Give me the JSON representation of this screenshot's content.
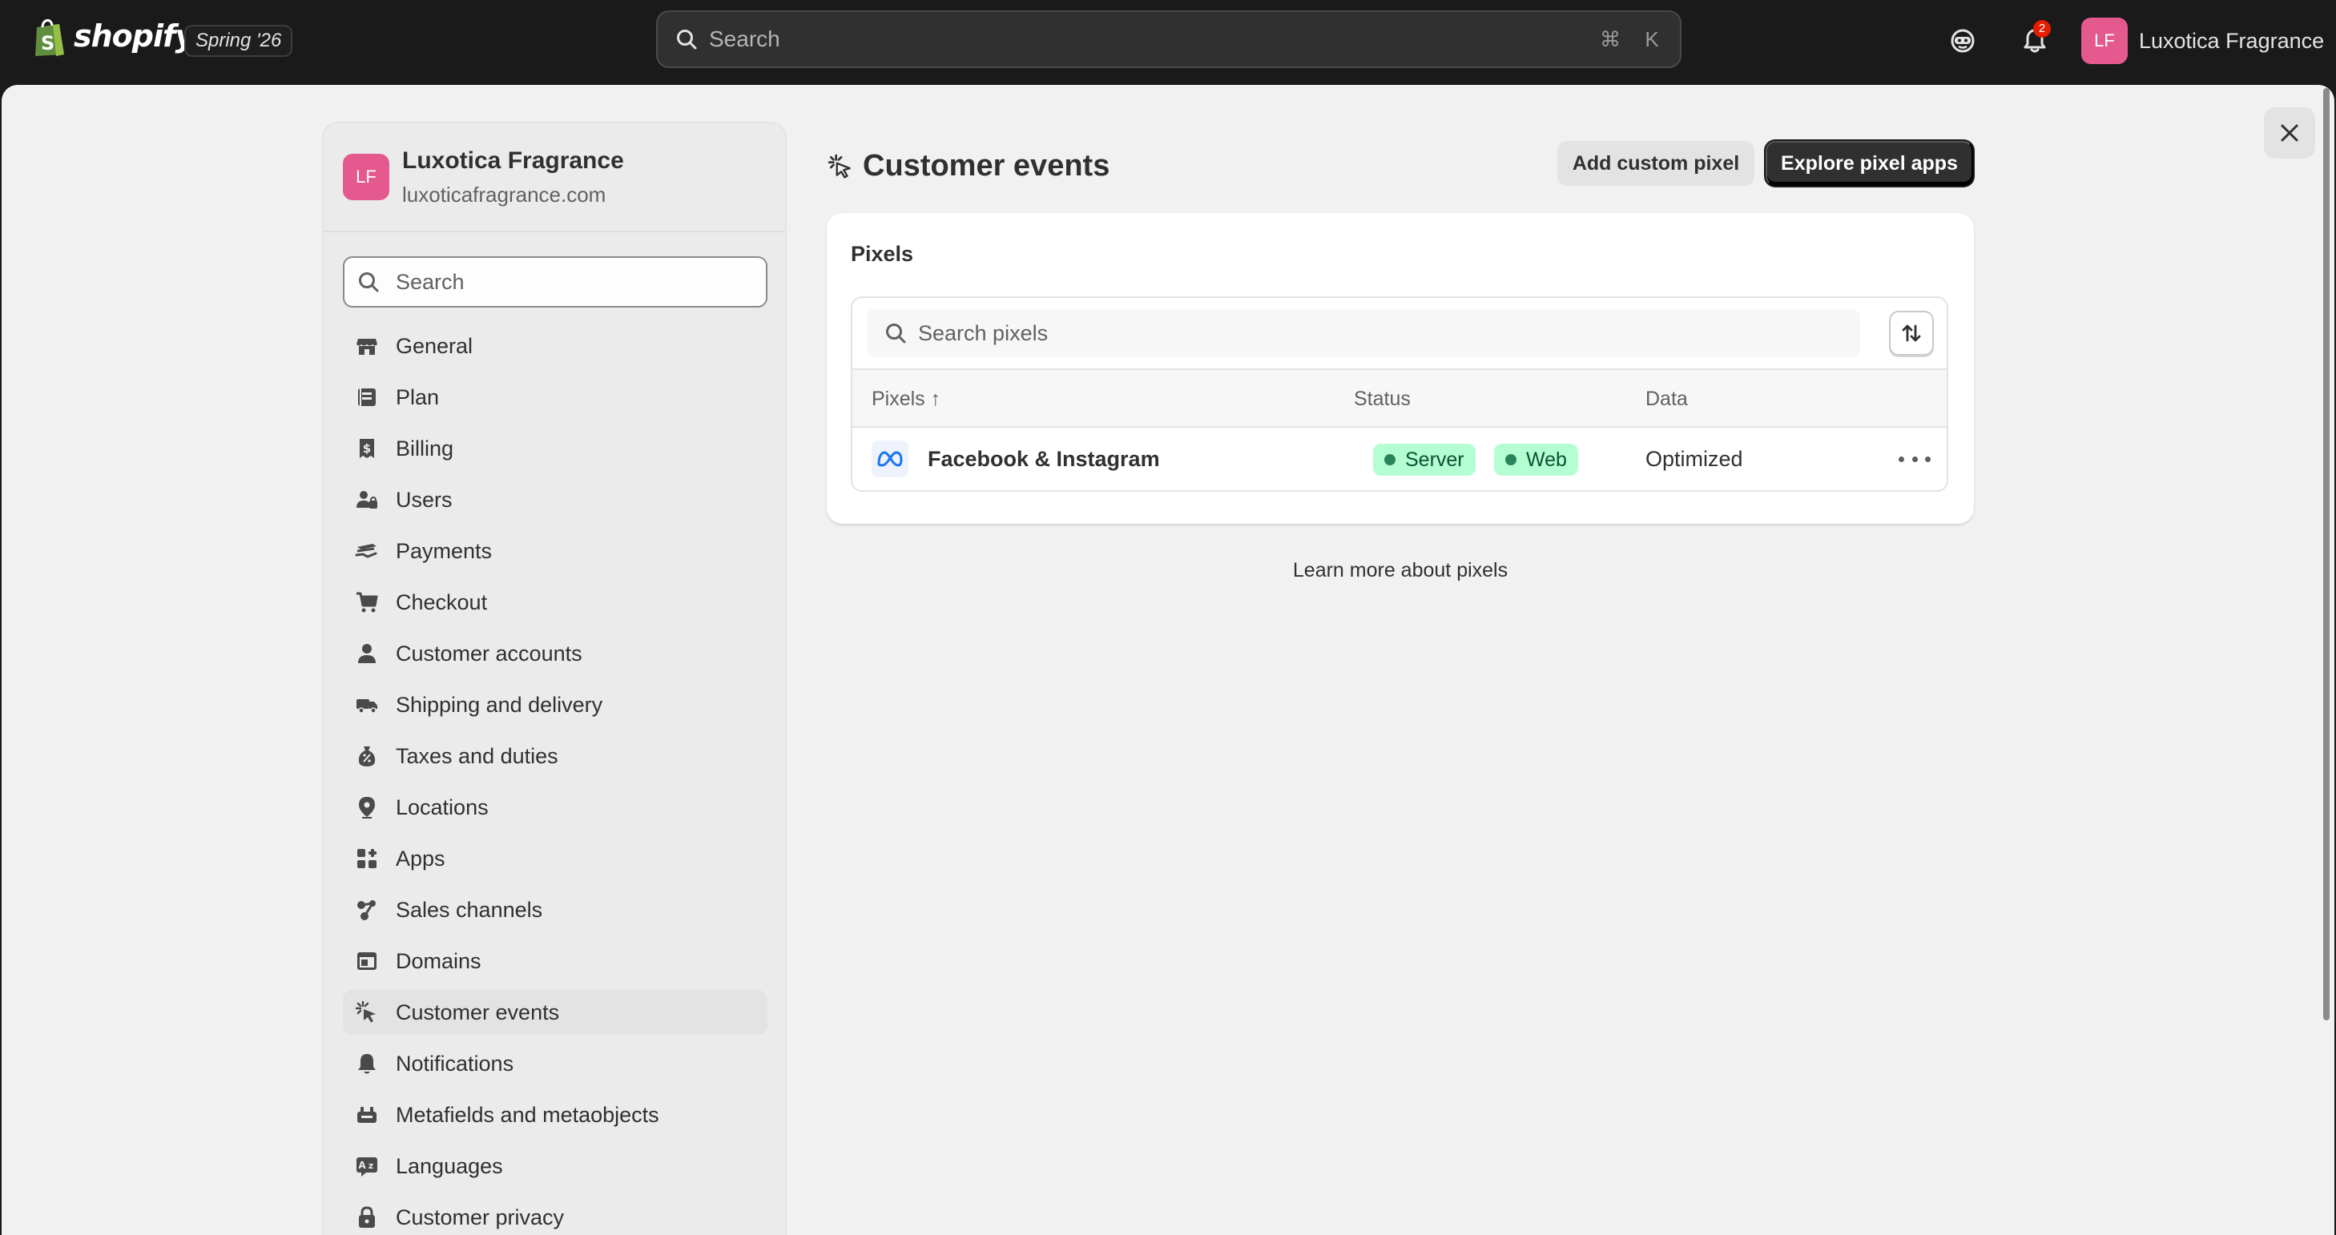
{
  "topbar": {
    "brand": "shopify",
    "edition_badge": "Spring '26",
    "search_placeholder": "Search",
    "shortcut_keys": [
      "⌘",
      "K"
    ],
    "notification_count": "2",
    "account_initials": "LF",
    "account_name": "Luxotica Fragrance"
  },
  "store": {
    "initials": "LF",
    "name": "Luxotica Fragrance",
    "domain": "luxoticafragrance.com"
  },
  "sidebar": {
    "search_placeholder": "Search",
    "items": [
      {
        "label": "General",
        "icon": "store-icon"
      },
      {
        "label": "Plan",
        "icon": "plan-icon"
      },
      {
        "label": "Billing",
        "icon": "receipt-dollar-icon"
      },
      {
        "label": "Users",
        "icon": "users-icon"
      },
      {
        "label": "Payments",
        "icon": "payments-icon"
      },
      {
        "label": "Checkout",
        "icon": "cart-icon"
      },
      {
        "label": "Customer accounts",
        "icon": "person-icon"
      },
      {
        "label": "Shipping and delivery",
        "icon": "truck-icon"
      },
      {
        "label": "Taxes and duties",
        "icon": "tax-icon"
      },
      {
        "label": "Locations",
        "icon": "location-pin-icon"
      },
      {
        "label": "Apps",
        "icon": "apps-icon"
      },
      {
        "label": "Sales channels",
        "icon": "sales-channels-icon"
      },
      {
        "label": "Domains",
        "icon": "domain-icon"
      },
      {
        "label": "Customer events",
        "icon": "cursor-click-icon",
        "active": true
      },
      {
        "label": "Notifications",
        "icon": "bell-icon"
      },
      {
        "label": "Metafields and metaobjects",
        "icon": "metafields-icon"
      },
      {
        "label": "Languages",
        "icon": "language-icon"
      },
      {
        "label": "Customer privacy",
        "icon": "lock-icon"
      }
    ]
  },
  "page": {
    "title": "Customer events",
    "add_custom_pixel": "Add custom pixel",
    "explore_pixel_apps": "Explore pixel apps",
    "card_title": "Pixels",
    "search_pixels_placeholder": "Search pixels",
    "columns": {
      "pixels": "Pixels",
      "sort_arrow": "↑",
      "status": "Status",
      "data": "Data"
    },
    "rows": [
      {
        "name": "Facebook & Instagram",
        "statuses": [
          "Server",
          "Web"
        ],
        "data": "Optimized",
        "icon": "meta-icon"
      }
    ],
    "learn_more": "Learn more about pixels"
  },
  "colors": {
    "topbar": "#1a1a1a",
    "avatar": "#e55a8e",
    "status_badge_bg": "#b4fed2",
    "status_badge_dot": "#29845a",
    "primary_button": "#303030"
  }
}
